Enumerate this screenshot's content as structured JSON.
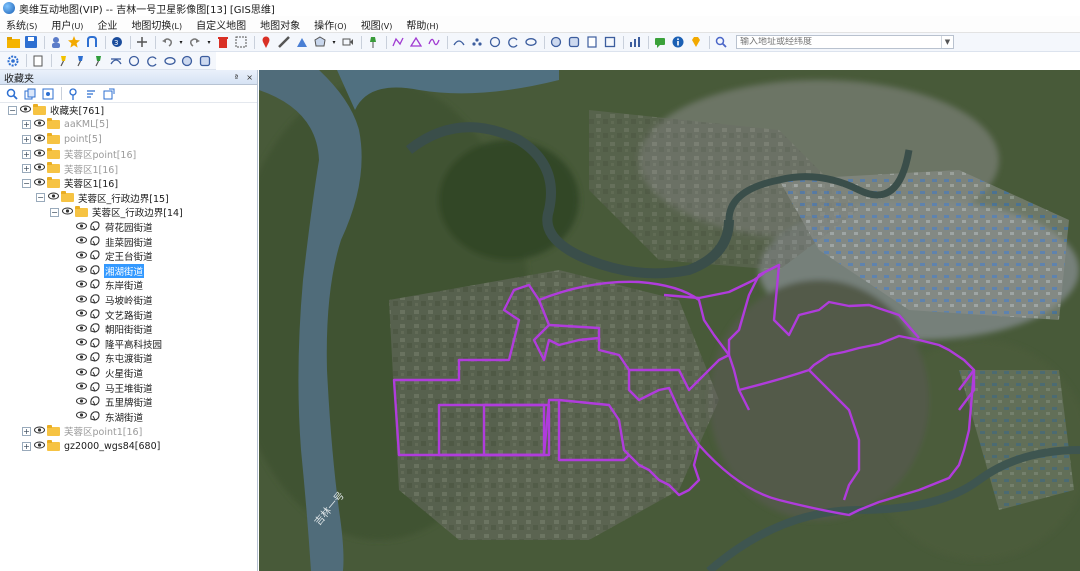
{
  "window": {
    "title": "奥维互动地图(VIP) -- 吉林一号卫星影像图[13] [GIS思维]"
  },
  "menu": [
    {
      "label": "系统",
      "hot": "(S)"
    },
    {
      "label": "用户",
      "hot": "(U)"
    },
    {
      "label": "企业",
      "hot": ""
    },
    {
      "label": "地图切换",
      "hot": "(L)"
    },
    {
      "label": "自定义地图",
      "hot": ""
    },
    {
      "label": "地图对象",
      "hot": ""
    },
    {
      "label": "操作",
      "hot": "(O)"
    },
    {
      "label": "视图",
      "hot": "(V)"
    },
    {
      "label": "帮助",
      "hot": "(H)"
    }
  ],
  "search": {
    "placeholder": "输入地址或经纬度"
  },
  "panel": {
    "title": "收藏夹",
    "pin": "ª",
    "close": "×"
  },
  "tree": [
    {
      "label": "收藏夹[761]",
      "level": 0,
      "exp": "−",
      "kind": "folder",
      "grey": false
    },
    {
      "label": "aaKML[5]",
      "level": 1,
      "exp": "+",
      "kind": "folder",
      "grey": true
    },
    {
      "label": "point[5]",
      "level": 1,
      "exp": "+",
      "kind": "folder",
      "grey": true
    },
    {
      "label": "芙蓉区point[16]",
      "level": 1,
      "exp": "+",
      "kind": "folder",
      "grey": true
    },
    {
      "label": "芙蓉区1[16]",
      "level": 1,
      "exp": "+",
      "kind": "folder",
      "grey": true
    },
    {
      "label": "芙蓉区1[16]",
      "level": 1,
      "exp": "−",
      "kind": "folder",
      "grey": false
    },
    {
      "label": "芙蓉区_行政边界[15]",
      "level": 2,
      "exp": "−",
      "kind": "folder",
      "grey": false
    },
    {
      "label": "芙蓉区_行政边界[14]",
      "level": 3,
      "exp": "−",
      "kind": "folder",
      "grey": false
    },
    {
      "label": "荷花园街道",
      "level": 4,
      "exp": "",
      "kind": "poly",
      "grey": false
    },
    {
      "label": "韭菜园街道",
      "level": 4,
      "exp": "",
      "kind": "poly",
      "grey": false
    },
    {
      "label": "定王台街道",
      "level": 4,
      "exp": "",
      "kind": "poly",
      "grey": false
    },
    {
      "label": "湘湖街道",
      "level": 4,
      "exp": "",
      "kind": "poly",
      "grey": false,
      "selected": true
    },
    {
      "label": "东岸街道",
      "level": 4,
      "exp": "",
      "kind": "poly",
      "grey": false
    },
    {
      "label": "马坡岭街道",
      "level": 4,
      "exp": "",
      "kind": "poly",
      "grey": false
    },
    {
      "label": "文艺路街道",
      "level": 4,
      "exp": "",
      "kind": "poly",
      "grey": false
    },
    {
      "label": "朝阳街街道",
      "level": 4,
      "exp": "",
      "kind": "poly",
      "grey": false
    },
    {
      "label": "隆平高科技园",
      "level": 4,
      "exp": "",
      "kind": "poly",
      "grey": false
    },
    {
      "label": "东屯渡街道",
      "level": 4,
      "exp": "",
      "kind": "poly",
      "grey": false
    },
    {
      "label": "火星街道",
      "level": 4,
      "exp": "",
      "kind": "poly",
      "grey": false
    },
    {
      "label": "马王堆街道",
      "level": 4,
      "exp": "",
      "kind": "poly",
      "grey": false
    },
    {
      "label": "五里牌街道",
      "level": 4,
      "exp": "",
      "kind": "poly",
      "grey": false
    },
    {
      "label": "东湖街道",
      "level": 4,
      "exp": "",
      "kind": "poly",
      "grey": false
    },
    {
      "label": "芙蓉区point1[16]",
      "level": 1,
      "exp": "+",
      "kind": "folder",
      "grey": true
    },
    {
      "label": "gz2000_wgs84[680]",
      "level": 1,
      "exp": "+",
      "kind": "folder",
      "grey": false
    }
  ],
  "map": {
    "boundary_color": "#b03cdc",
    "river_label": "吉林一号"
  }
}
